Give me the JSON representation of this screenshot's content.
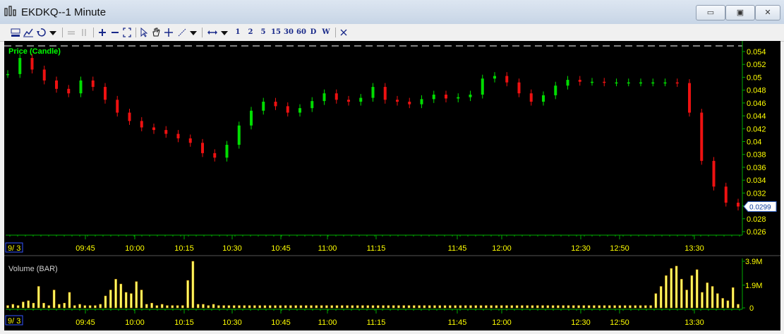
{
  "window": {
    "title": "EKDKQ--1 Minute",
    "minimize_label": "▭",
    "restore_label": "▣",
    "close_label": "✕"
  },
  "toolbar": {
    "interval_buttons": [
      "1",
      "2",
      "5",
      "15",
      "30",
      "60",
      "D",
      "W"
    ]
  },
  "colors": {
    "background": "#000000",
    "up_candle": "#00dd00",
    "down_candle": "#ee1111",
    "axis_text": "#ffff00",
    "grid_line": "#00aa00",
    "volume_bar": "#ffff66",
    "panel_title": "#00ff00"
  },
  "chart_data": [
    {
      "type": "candlestick",
      "title": "Price (Candle)",
      "ylim": [
        0.026,
        0.054
      ],
      "y_ticks": [
        "0.054",
        "0.052",
        "0.05",
        "0.048",
        "0.046",
        "0.044",
        "0.042",
        "0.04",
        "0.038",
        "0.036",
        "0.034",
        "0.032",
        "0.03",
        "0.028",
        "0.026"
      ],
      "last_price_label": "0.0299",
      "date_label": "9/ 3",
      "x_tick_labels": [
        "09:45",
        "10:00",
        "10:15",
        "10:30",
        "10:45",
        "11:00",
        "11:15",
        "11:45",
        "12:00",
        "12:30",
        "12:50",
        "13:30"
      ],
      "series": [
        {
          "name": "price",
          "values": [
            0.0505,
            0.053,
            0.0512,
            0.0495,
            0.0482,
            0.0475,
            0.0495,
            0.0485,
            0.0465,
            0.0445,
            0.0432,
            0.0422,
            0.0418,
            0.0412,
            0.0405,
            0.0398,
            0.0382,
            0.0375,
            0.0395,
            0.0425,
            0.0448,
            0.0462,
            0.0455,
            0.0445,
            0.0452,
            0.0463,
            0.0475,
            0.0465,
            0.0462,
            0.0468,
            0.0485,
            0.0465,
            0.0462,
            0.0458,
            0.0466,
            0.0473,
            0.0467,
            0.0469,
            0.0473,
            0.0498,
            0.0502,
            0.0492,
            0.0475,
            0.0462,
            0.0472,
            0.0487,
            0.0496,
            0.0493,
            0.0493,
            0.0492,
            0.0492,
            0.0492,
            0.0492,
            0.0492,
            0.0492,
            0.0491,
            0.0445,
            0.037,
            0.033,
            0.0305,
            0.0299
          ]
        }
      ]
    },
    {
      "type": "bar",
      "title": "Volume (BAR)",
      "y_ticks": [
        "3.9M",
        "1.9M",
        "0"
      ],
      "ylim": [
        0,
        3.9
      ],
      "series": [
        {
          "name": "volume",
          "values": [
            0.2,
            0.3,
            0.2,
            0.5,
            0.6,
            0.4,
            1.8,
            0.4,
            0.2,
            1.5,
            0.3,
            0.4,
            1.3,
            0.2,
            0.3,
            0.2,
            0.2,
            0.2,
            0.3,
            1.0,
            1.5,
            2.4,
            2.0,
            1.3,
            1.2,
            2.2,
            1.5,
            0.3,
            0.4,
            0.2,
            0.3,
            0.2,
            0.2,
            0.2,
            0.2,
            2.3,
            3.9,
            0.3,
            0.3,
            0.2,
            0.3,
            0.2,
            0.2,
            0.2,
            0.2,
            0.2,
            0.2,
            0.2,
            0.2,
            0.2,
            0.2,
            0.2,
            0.2,
            0.2,
            0.2,
            0.2,
            0.2,
            0.2,
            0.2,
            0.2,
            0.2,
            0.2,
            0.2,
            0.2,
            0.2,
            0.2,
            0.2,
            0.2,
            0.2,
            0.2,
            0.2,
            0.2,
            0.2,
            0.2,
            0.2,
            0.2,
            0.2,
            0.2,
            0.2,
            0.2,
            0.2,
            0.2,
            0.2,
            0.2,
            0.2,
            0.2,
            0.2,
            0.2,
            0.2,
            0.2,
            0.2,
            0.2,
            0.2,
            0.2,
            0.2,
            0.2,
            0.2,
            0.2,
            0.2,
            0.2,
            0.2,
            0.2,
            0.2,
            0.2,
            0.2,
            0.2,
            0.2,
            0.2,
            0.2,
            0.2,
            0.2,
            0.2,
            0.2,
            0.2,
            0.2,
            0.2,
            0.2,
            0.2,
            0.2,
            0.2,
            0.2,
            0.2,
            0.2,
            0.2,
            0.2,
            0.2,
            1.2,
            1.8,
            2.7,
            3.3,
            3.5,
            2.4,
            1.5,
            2.7,
            3.2,
            1.3,
            2.1,
            1.8,
            1.2,
            0.8,
            0.6,
            1.7,
            0.3
          ]
        }
      ]
    }
  ]
}
